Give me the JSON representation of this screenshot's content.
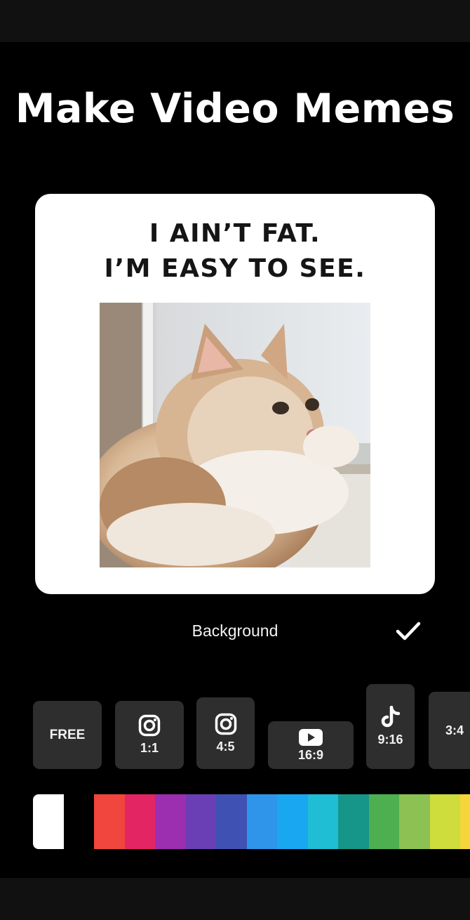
{
  "headline": "Make Video Memes",
  "preview": {
    "caption_line1": "I AIN’T FAT.",
    "caption_line2": "I’M EASY TO SEE."
  },
  "background_label": "Background",
  "ratios": [
    {
      "label": "FREE",
      "icon": null
    },
    {
      "label": "1:1",
      "icon": "instagram-icon"
    },
    {
      "label": "4:5",
      "icon": "instagram-icon"
    },
    {
      "label": "16:9",
      "icon": "youtube-icon"
    },
    {
      "label": "9:16",
      "icon": "tiktok-icon"
    },
    {
      "label": "3:4",
      "icon": null
    }
  ],
  "colors": {
    "background": "#000000",
    "bar": "#111111",
    "tile": "#2e2e2e",
    "card": "#ffffff",
    "caption_text": "#151515"
  },
  "palette": [
    "#ffffff",
    "#000000",
    "#f0463d",
    "#e32663",
    "#9c2eb0",
    "#6a3fb5",
    "#3f52b4",
    "#2e95eb",
    "#1aa7f1",
    "#1fbed4",
    "#169688",
    "#4eaf51",
    "#8cc153",
    "#cedc3c",
    "#f5d63a"
  ]
}
